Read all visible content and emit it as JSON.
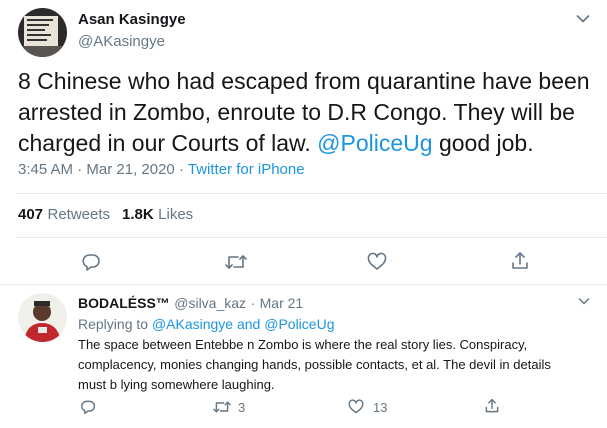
{
  "tweet": {
    "author_name": "Asan Kasingye",
    "author_handle": "@AKasingye",
    "text_lines": [
      "8 Chinese who had escaped from quarantine have been",
      "arrested in Zombo, enroute to D.R Congo. They will be",
      "charged in our Courts of law. "
    ],
    "mention": "@PoliceUg",
    "text_tail": " good job.",
    "time": "3:45 AM",
    "separator": "·",
    "date": "Mar 21, 2020",
    "source": "Twitter for iPhone",
    "retweets_count": "407",
    "retweets_label": "Retweets",
    "likes_count": "1.8K",
    "likes_label": "Likes"
  },
  "reply": {
    "author_name": "BODALÉSS™",
    "author_handle": "@silva_kaz",
    "separator": "·",
    "date": "Mar 21",
    "replying_to_label": "Replying to",
    "replying_to_user1": "@AKasingye",
    "replying_to_and": "and",
    "replying_to_user2": "@PoliceUg",
    "text_lines": [
      "The space between Entebbe n Zombo is where the real story lies. Conspiracy,",
      "complacency, monies changing hands, possible contacts, et al. The devil in details",
      "must b lying somewhere laughing."
    ],
    "retweet_count": "3",
    "like_count": "13"
  },
  "icons": {
    "tweet_menu": "chevron-down-icon",
    "reply": "reply-icon",
    "retweet": "retweet-icon",
    "like": "heart-icon",
    "share": "share-icon"
  },
  "colors": {
    "link": "#1b95e0",
    "secondary_text": "#657786",
    "divider": "#e6ecf0"
  }
}
